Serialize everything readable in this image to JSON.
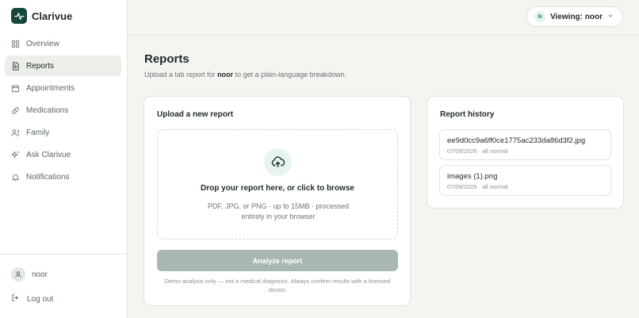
{
  "brand": {
    "name": "Clarivue"
  },
  "nav": {
    "items": [
      {
        "label": "Overview",
        "icon": "grid-icon",
        "active": false
      },
      {
        "label": "Reports",
        "icon": "document-icon",
        "active": true
      },
      {
        "label": "Appointments",
        "icon": "calendar-icon",
        "active": false
      },
      {
        "label": "Medications",
        "icon": "pill-icon",
        "active": false
      },
      {
        "label": "Family",
        "icon": "people-icon",
        "active": false
      },
      {
        "label": "Ask Clarivue",
        "icon": "sparkle-icon",
        "active": false
      },
      {
        "label": "Notifications",
        "icon": "bell-icon",
        "active": false
      }
    ]
  },
  "sidebar_footer": {
    "user_name": "noor",
    "logout_label": "Log out"
  },
  "topbar": {
    "viewing_initial": "N",
    "viewing_label": "Viewing: noor"
  },
  "page": {
    "title": "Reports",
    "subtitle_prefix": "Upload a lab report for ",
    "subtitle_user": "noor",
    "subtitle_suffix": " to get a plain-language breakdown."
  },
  "upload": {
    "title": "Upload a new report",
    "drop_title": "Drop your report here, or click to browse",
    "drop_hint": "PDF, JPG, or PNG · up to 15MB · processed entirely in your browser",
    "analyze_label": "Analyze report",
    "disclaimer": "Demo analysis only — not a medical diagnosis. Always confirm results with a licensed doctor."
  },
  "history": {
    "title": "Report history",
    "items": [
      {
        "name": "ee9d0cc9a6ff0ce1775ac233da86d3f2.jpg",
        "meta": "07/09/2026 · all normal"
      },
      {
        "name": "images (1).png",
        "meta": "07/09/2026 · all normal"
      }
    ]
  },
  "colors": {
    "brand": "#16453c",
    "accent": "#2f8b63",
    "button_disabled": "#a9b7b2",
    "background": "#f4f4f1"
  }
}
